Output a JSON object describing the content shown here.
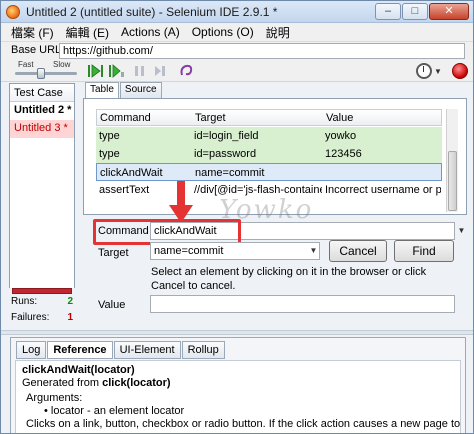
{
  "window": {
    "title": "Untitled 2 (untitled suite) - Selenium IDE 2.9.1 *",
    "minimize_label": "–",
    "maximize_label": "□",
    "close_label": "✕"
  },
  "menu": {
    "items": [
      "檔案 (F)",
      "編輯 (E)",
      "Actions (A)",
      "Options (O)",
      "說明"
    ]
  },
  "base_url": {
    "label": "Base URL",
    "value": "https://github.com/"
  },
  "toolbar": {
    "speed_fast": "Fast",
    "speed_slow": "Slow",
    "speed_level": 0.4
  },
  "test_cases": {
    "header": "Test Case",
    "items": [
      {
        "name": "Untitled 2 *",
        "state": "current"
      },
      {
        "name": "Untitled 3 *",
        "state": "failed"
      }
    ],
    "runs_label": "Runs:",
    "runs_value": "2",
    "failures_label": "Failures:",
    "failures_value": "1"
  },
  "editor_tabs": [
    "Table",
    "Source"
  ],
  "table": {
    "columns": [
      "Command",
      "Target",
      "Value"
    ],
    "rows": [
      {
        "command": "type",
        "target": "id=login_field",
        "value": "yowko",
        "status": "passed"
      },
      {
        "command": "type",
        "target": "id=password",
        "value": "123456",
        "status": "passed"
      },
      {
        "command": "clickAndWait",
        "target": "name=commit",
        "value": "",
        "status": "selected"
      },
      {
        "command": "assertText",
        "target": "//div[@id='js-flash-containe...",
        "value": "Incorrect username or pas...",
        "status": "none"
      }
    ]
  },
  "watermark": "Yowko",
  "command": {
    "label": "Command",
    "value": "clickAndWait",
    "target_label": "Target",
    "target_value": "name=commit",
    "cancel_label": "Cancel",
    "find_label": "Find",
    "hint": "Select an element by clicking on it in the browser or click Cancel to cancel.",
    "value_label": "Value",
    "value_value": ""
  },
  "bottom_tabs": [
    "Log",
    "Reference",
    "UI-Element",
    "Rollup"
  ],
  "reference": {
    "title": "clickAndWait(locator)",
    "generated_prefix": "Generated from ",
    "generated_from": "click(locator)",
    "arguments_label": "Arguments:",
    "argument_item": "locator - an element locator",
    "description": "Clicks on a link, button, checkbox or radio button. If the click action causes a new page to load"
  },
  "colors": {
    "passed_row": "#d8f0cf",
    "failed_case": "#ffd4d4",
    "highlight": "#e53333"
  }
}
